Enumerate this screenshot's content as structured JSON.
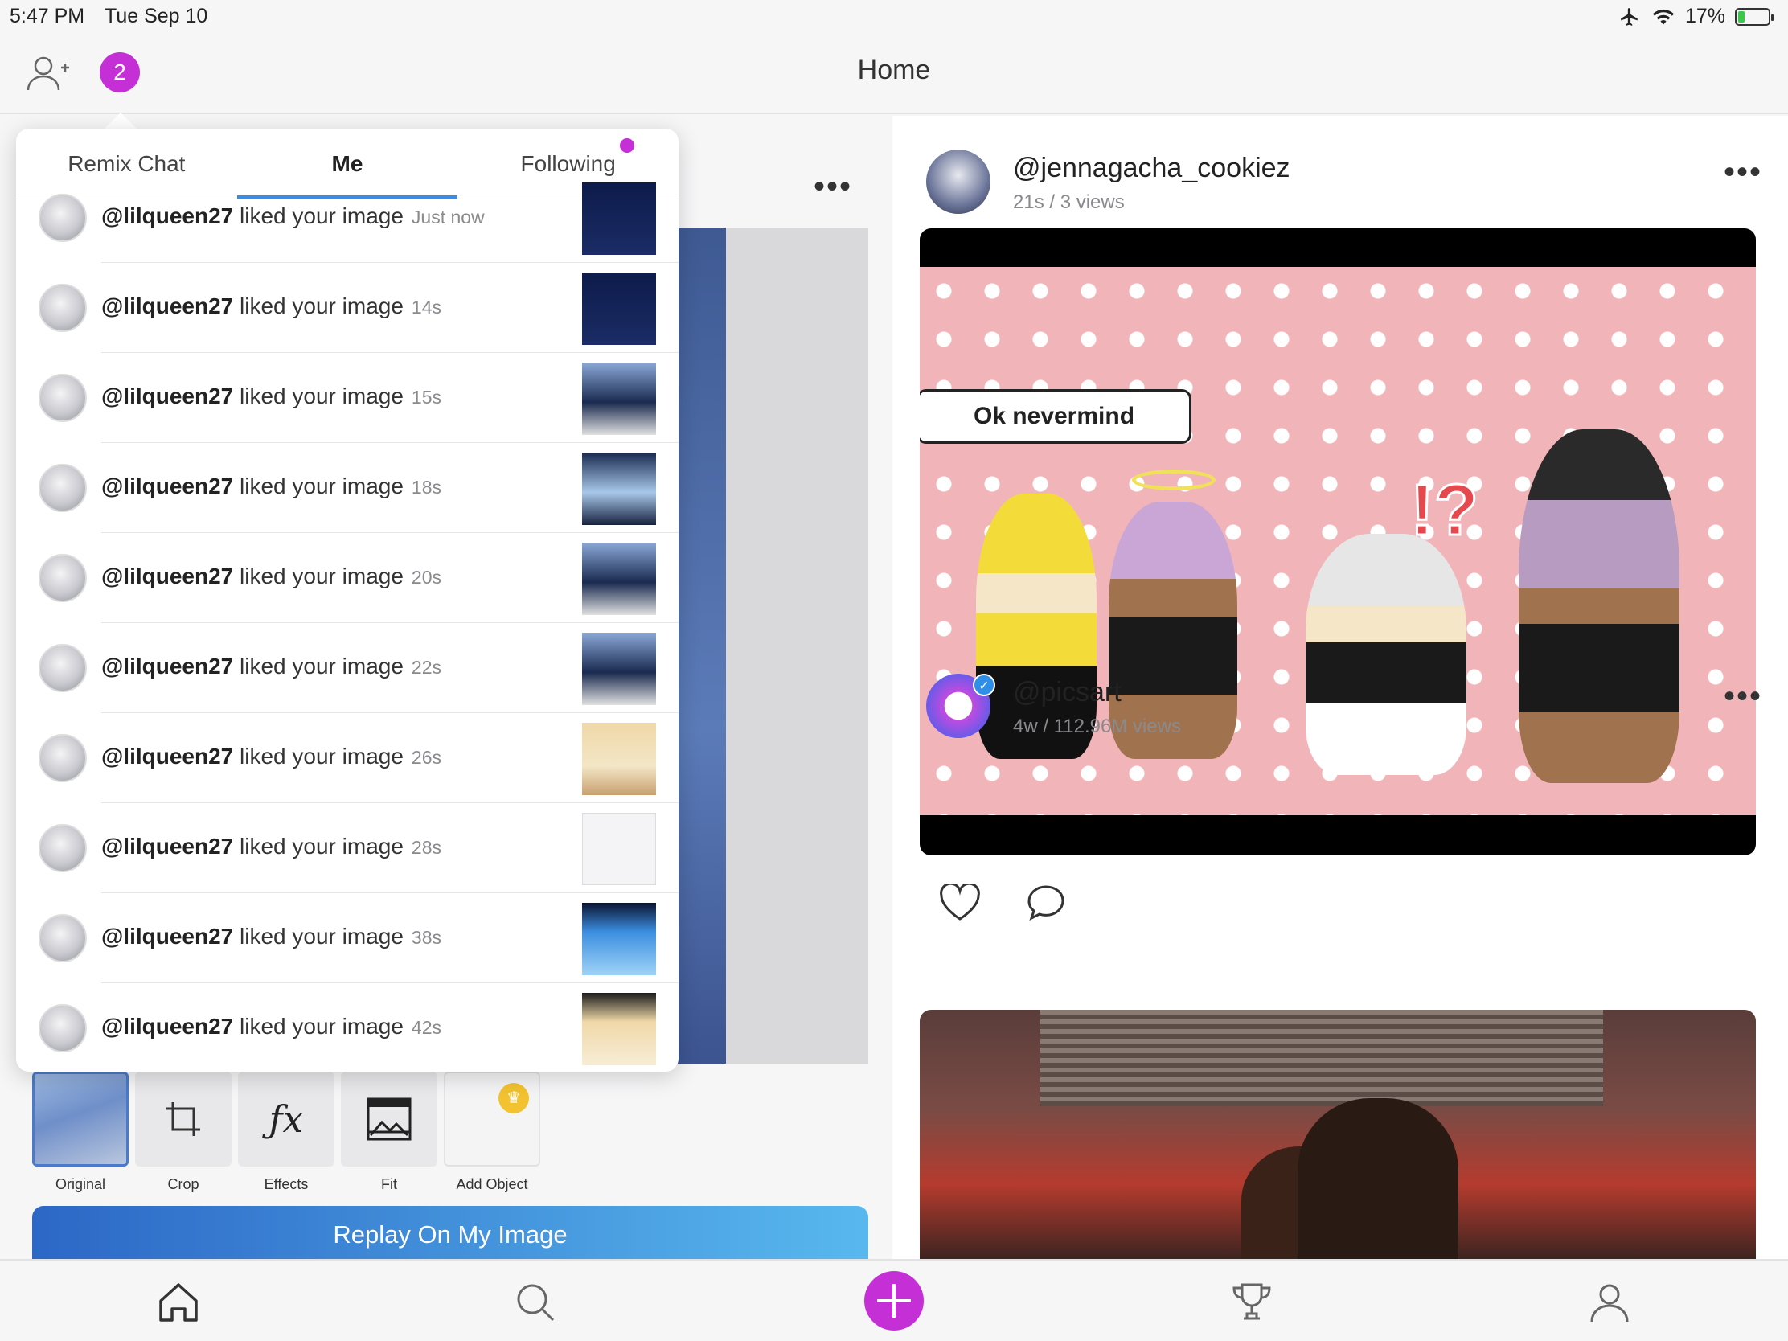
{
  "status_bar": {
    "time": "5:47 PM",
    "date": "Tue Sep 10",
    "battery": "17%"
  },
  "header": {
    "title": "Home",
    "notification_count": "2"
  },
  "notifications": {
    "tabs": [
      {
        "label": "Remix Chat"
      },
      {
        "label": "Me"
      },
      {
        "label": "Following"
      }
    ],
    "items": [
      {
        "user": "@lilqueen27",
        "action": "liked your image",
        "time": "Just now"
      },
      {
        "user": "@lilqueen27",
        "action": "liked your image",
        "time": "14s"
      },
      {
        "user": "@lilqueen27",
        "action": "liked your image",
        "time": "15s"
      },
      {
        "user": "@lilqueen27",
        "action": "liked your image",
        "time": "18s"
      },
      {
        "user": "@lilqueen27",
        "action": "liked your image",
        "time": "20s"
      },
      {
        "user": "@lilqueen27",
        "action": "liked your image",
        "time": "22s"
      },
      {
        "user": "@lilqueen27",
        "action": "liked your image",
        "time": "26s"
      },
      {
        "user": "@lilqueen27",
        "action": "liked your image",
        "time": "28s"
      },
      {
        "user": "@lilqueen27",
        "action": "liked your image",
        "time": "38s"
      },
      {
        "user": "@lilqueen27",
        "action": "liked your image",
        "time": "42s"
      }
    ]
  },
  "remix": {
    "tools": [
      {
        "label": "Original"
      },
      {
        "label": "Crop"
      },
      {
        "label": "Effects"
      },
      {
        "label": "Fit"
      },
      {
        "label": "Add Object"
      }
    ],
    "replay_button": "Replay On My Image"
  },
  "feed": {
    "posts": [
      {
        "username": "@jennagacha_cookiez",
        "meta": "21s / 3 views",
        "speech_bubble": "Ok nevermind"
      },
      {
        "username": "@picsart",
        "meta": "4w / 112.96M views"
      }
    ]
  },
  "colors": {
    "accent": "#c42fd6",
    "tab_underline": "#3b8de0",
    "replay_gradient_start": "#2c67c6",
    "replay_gradient_end": "#58b8ee"
  }
}
